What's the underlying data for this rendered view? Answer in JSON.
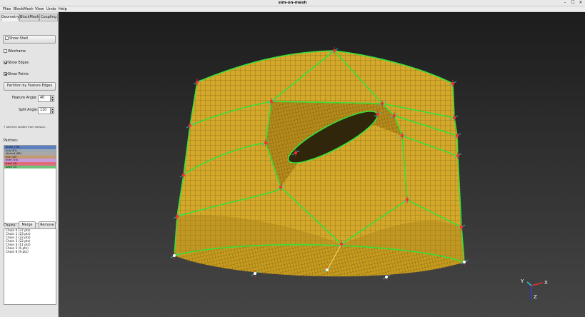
{
  "window": {
    "title": "sim-on-mesh",
    "minimize": "–",
    "maximize": "☐",
    "close": "✕"
  },
  "menu": [
    "Files",
    "BlockMesh",
    "View",
    "Undo",
    "Help"
  ],
  "tabs": [
    "Geometry",
    "BlockMesh",
    "Coupling"
  ],
  "geometry": {
    "show_shell_label": "Show Shell",
    "wireframe_label": "Wireframe",
    "show_edges_label": "Show Edges",
    "show_points_label": "Show Points",
    "show_shell_checked": false,
    "wireframe_checked": false,
    "show_edges_checked": true,
    "show_points_checked": true,
    "partition_button": "Partition by Feature Edges",
    "feature_angle_label": "Feature Angle:",
    "feature_angle_value": "40",
    "split_angle_label": "Split Angle:",
    "split_angle_value": "110",
    "status_text": "7 patches loaded from session.",
    "patches_label": "Patches:",
    "patches": [
      {
        "name": "blade (78)",
        "color": "#5b80c2"
      },
      {
        "name": "hub (81)",
        "color": "#9fa9b0"
      },
      {
        "name": "shroud (66)",
        "color": "#a8a8a8"
      },
      {
        "name": "out (18)",
        "color": "#c49a6c"
      },
      {
        "name": "inlet (10)",
        "color": "#c99ad9"
      },
      {
        "name": "front (4)",
        "color": "#e06c7a"
      },
      {
        "name": "back (2)",
        "color": "#6fc27a"
      }
    ],
    "chains_label": "Chains:",
    "merge_button": "Merge",
    "remove_button": "Remove",
    "chains": [
      "Chain 0 (37 pts)",
      "Chain 1 (23 pts)",
      "Chain 2 (22 pts)",
      "Chain 3 (22 pts)",
      "Chain 4 (11 pts)",
      "Chain 5 (6 pts)",
      "Chain 6 (9 pts)"
    ]
  },
  "axes": {
    "x": "X",
    "y": "Y",
    "z": "Z"
  },
  "colors": {
    "mesh_face": "#d4a82a",
    "mesh_dark": "#b8901e",
    "feature_edge": "#35e03a",
    "point": "#ff2a2a",
    "axis_x": "#e03030",
    "axis_y": "#20c8d8",
    "axis_z": "#3040e0"
  }
}
